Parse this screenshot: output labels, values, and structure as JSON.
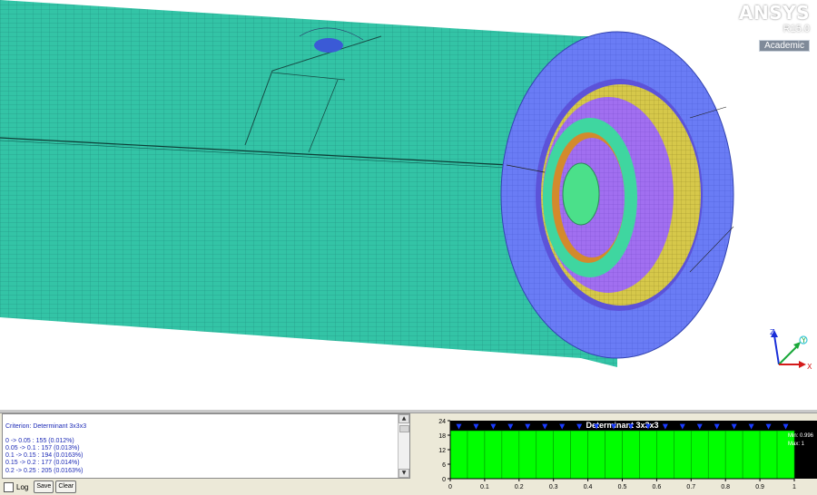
{
  "app": {
    "brand": "ANSYS",
    "version": "R15.0",
    "edition": "Academic"
  },
  "triad": {
    "axes": [
      "Z",
      "Y",
      "X"
    ]
  },
  "mesh_metrics": {
    "criterion_line": "Criterion: Determinant 3x3x3",
    "bins": [
      "0 -> 0.05 : 155 (0.012%)",
      "0.05 -> 0.1 : 157 (0.013%)",
      "0.1 -> 0.15 : 194 (0.0163%)",
      "0.15 -> 0.2 : 177 (0.014%)",
      "0.2 -> 0.25 : 205 (0.0163%)"
    ],
    "log_label": "Log",
    "buttons": {
      "save": "Save",
      "clear": "Clear"
    }
  },
  "chart_data": {
    "type": "bar",
    "title": "Determinant 3x3x3",
    "ylim": [
      0,
      24
    ],
    "yticks": [
      "0",
      "6",
      "12",
      "18",
      "24"
    ],
    "xlim": [
      0,
      1
    ],
    "xticks": [
      "0",
      "0.1",
      "0.2",
      "0.3",
      "0.4",
      "0.5",
      "0.6",
      "0.7",
      "0.8",
      "0.9",
      "1"
    ],
    "bin_edges": [
      0,
      0.05,
      0.1,
      0.15,
      0.2,
      0.25,
      0.3,
      0.35,
      0.4,
      0.45,
      0.5,
      0.55,
      0.6,
      0.65,
      0.7,
      0.75,
      0.8,
      0.85,
      0.9,
      0.95,
      1.0
    ],
    "values": [
      19.8,
      19.8,
      19.8,
      19.8,
      19.8,
      19.8,
      19.8,
      19.8,
      19.8,
      19.8,
      19.8,
      19.8,
      19.8,
      19.8,
      19.8,
      19.8,
      19.8,
      19.8,
      19.8,
      19.8
    ],
    "marker_value": 21.5,
    "min_label": "Min: 0.996",
    "max_label": "Max: 1",
    "colors": {
      "bar": "#00ff00",
      "marker": "#1a3cff",
      "background": "#000000",
      "title": "#ffffff"
    }
  }
}
